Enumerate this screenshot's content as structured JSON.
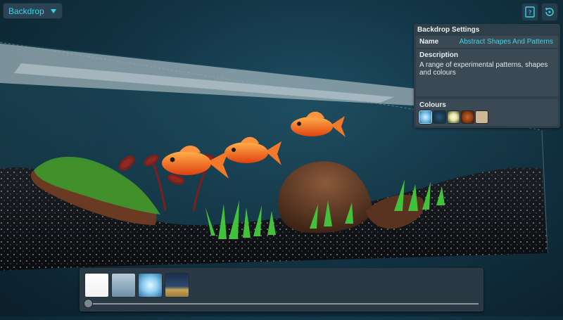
{
  "top_bar": {
    "dropdown_label": "Backdrop",
    "help_icon": "help-icon",
    "reset_icon": "reset-rotate-icon"
  },
  "panel": {
    "title": "Backdrop Settings",
    "name_label": "Name",
    "name_value": "Abstract Shapes And Patterns",
    "description_label": "Description",
    "description_text": "A range of experimental patterns, shapes and colours",
    "colours_label": "Colours",
    "colours": [
      "#6fb7e4",
      "#16344a",
      "#e8e6a2",
      "#8a3a12",
      "#cdb896"
    ],
    "selected_colour_index": 0
  },
  "thumbnails": {
    "items": [
      {
        "id": "white",
        "style": "linear-gradient(#ffffff,#f1f1f1)"
      },
      {
        "id": "blue-fade",
        "style": "linear-gradient(#b6ccdb,#6f8fa6)"
      },
      {
        "id": "blue-glow",
        "style": "radial-gradient(circle,#e6f7ff 0%,#8ccdf0 45%,#2a6fa0 100%)"
      },
      {
        "id": "dune",
        "style": "linear-gradient(#1b2d4a 0%,#2c4a6e 55%,#c7a458 70%,#9b7a3b 100%)"
      }
    ],
    "slider_value": 0
  },
  "accent": "#38d3e6"
}
